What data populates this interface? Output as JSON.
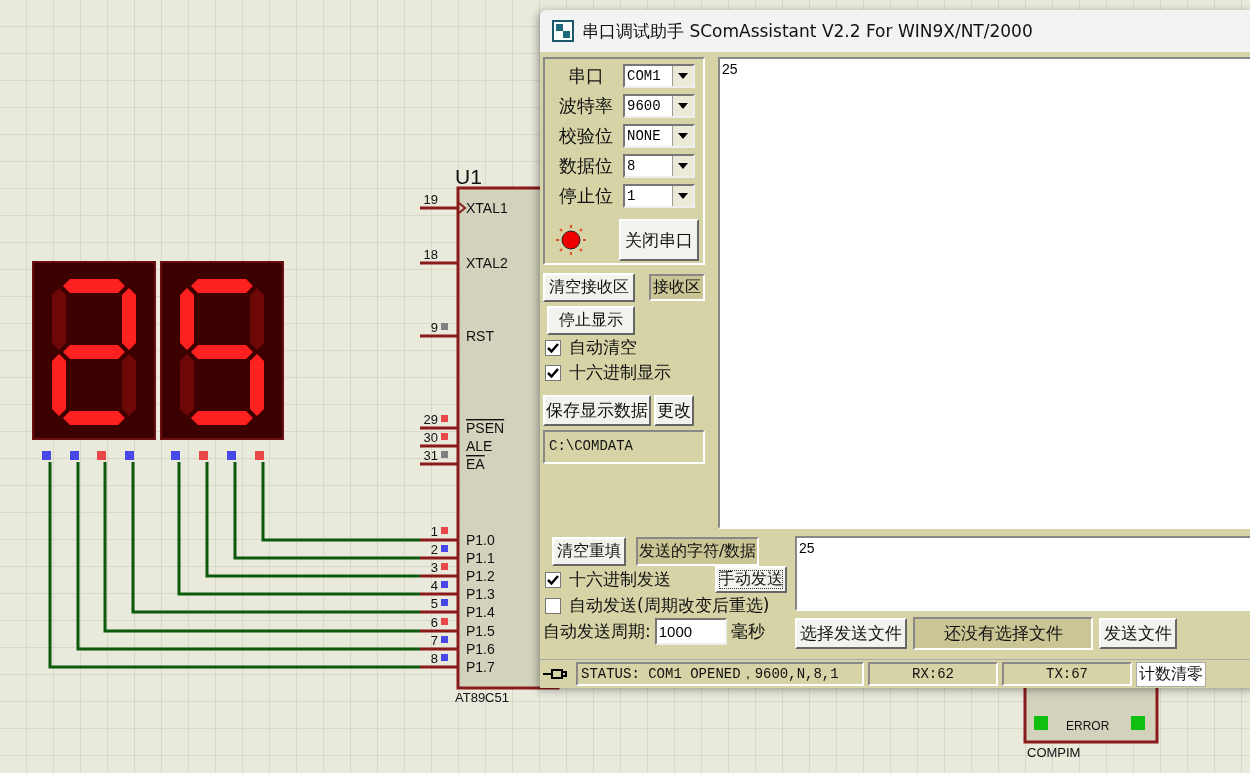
{
  "schematic": {
    "chip": {
      "ref": "U1",
      "part": "AT89C51",
      "pins": [
        {
          "number": "19",
          "label": "XTAL1",
          "clock": true,
          "overline": false
        },
        {
          "number": "18",
          "label": "XTAL2",
          "clock": false,
          "overline": false
        },
        {
          "number": "9",
          "label": "RST",
          "clock": false,
          "overline": false,
          "color": "#808080"
        },
        {
          "number": "29",
          "label": "PSEN",
          "clock": false,
          "overline": true,
          "color": "#e84848"
        },
        {
          "number": "30",
          "label": "ALE",
          "clock": false,
          "overline": false,
          "color": "#e84848"
        },
        {
          "number": "31",
          "label": "EA",
          "clock": false,
          "overline": true,
          "color": "#808080"
        },
        {
          "number": "1",
          "label": "P1.0",
          "clock": false,
          "overline": false,
          "color": "#e84848"
        },
        {
          "number": "2",
          "label": "P1.1",
          "clock": false,
          "overline": false,
          "color": "#4848e8"
        },
        {
          "number": "3",
          "label": "P1.2",
          "clock": false,
          "overline": false,
          "color": "#e84848"
        },
        {
          "number": "4",
          "label": "P1.3",
          "clock": false,
          "overline": false,
          "color": "#4848e8"
        },
        {
          "number": "5",
          "label": "P1.4",
          "clock": false,
          "overline": false,
          "color": "#4848e8"
        },
        {
          "number": "6",
          "label": "P1.5",
          "clock": false,
          "overline": false,
          "color": "#e84848"
        },
        {
          "number": "7",
          "label": "P1.6",
          "clock": false,
          "overline": false,
          "color": "#4848e8"
        },
        {
          "number": "8",
          "label": "P1.7",
          "clock": false,
          "overline": false,
          "color": "#4848e8"
        }
      ]
    },
    "displays": [
      {
        "segments": [
          {
            "lit": true
          },
          {
            "lit": true
          },
          {
            "lit": false
          },
          {
            "lit": true
          },
          {
            "lit": true
          },
          {
            "lit": false
          },
          {
            "lit": true
          }
        ],
        "pins": [
          {
            "color": "#4848e8"
          },
          {
            "color": "#4848e8"
          },
          {
            "color": "#e84848"
          },
          {
            "color": "#4848e8"
          }
        ]
      },
      {
        "segments": [
          {
            "lit": true
          },
          {
            "lit": false
          },
          {
            "lit": true
          },
          {
            "lit": true
          },
          {
            "lit": false
          },
          {
            "lit": true
          },
          {
            "lit": true
          }
        ],
        "pins": [
          {
            "color": "#4848e8"
          },
          {
            "color": "#e84848"
          },
          {
            "color": "#4848e8"
          },
          {
            "color": "#e84848"
          }
        ]
      }
    ],
    "compim": {
      "label": "COMPIM",
      "status": "ERROR"
    }
  },
  "window": {
    "title": "串口调试助手 SComAssistant V2.2 For WIN9X/NT/2000",
    "port": {
      "settings": [
        {
          "label": "串口",
          "value": "COM1"
        },
        {
          "label": "波特率",
          "value": "9600"
        },
        {
          "label": "校验位",
          "value": "NONE"
        },
        {
          "label": "数据位",
          "value": "8"
        },
        {
          "label": "停止位",
          "value": "1"
        }
      ],
      "led_on": true,
      "close_button": "关闭串口"
    },
    "receive": {
      "clear_button": "清空接收区",
      "area_label": "接收区",
      "stop_button": "停止显示",
      "options": [
        {
          "label": "自动清空",
          "checked": true
        },
        {
          "label": "十六进制显示",
          "checked": true
        }
      ],
      "save_button": "保存显示数据",
      "change_button": "更改",
      "path": "C:\\COMDATA",
      "content": "25"
    },
    "send": {
      "clear_button": "清空重填",
      "area_label": "发送的字符/数据",
      "content": "25",
      "hex": {
        "label": "十六进制发送",
        "checked": true
      },
      "manual_button": "手动发送",
      "auto": {
        "label": "自动发送(周期改变后重选)",
        "checked": false
      },
      "period_label": "自动发送周期:",
      "period": "1000",
      "unit": "毫秒",
      "select_file_button": "选择发送文件",
      "file_status": "还没有选择文件",
      "send_file_button": "发送文件"
    },
    "status_bar": {
      "status": "STATUS: COM1 OPENED，9600,N,8,1",
      "rx": "RX:62",
      "tx": "TX:67",
      "reset_button": "计数清零"
    }
  }
}
